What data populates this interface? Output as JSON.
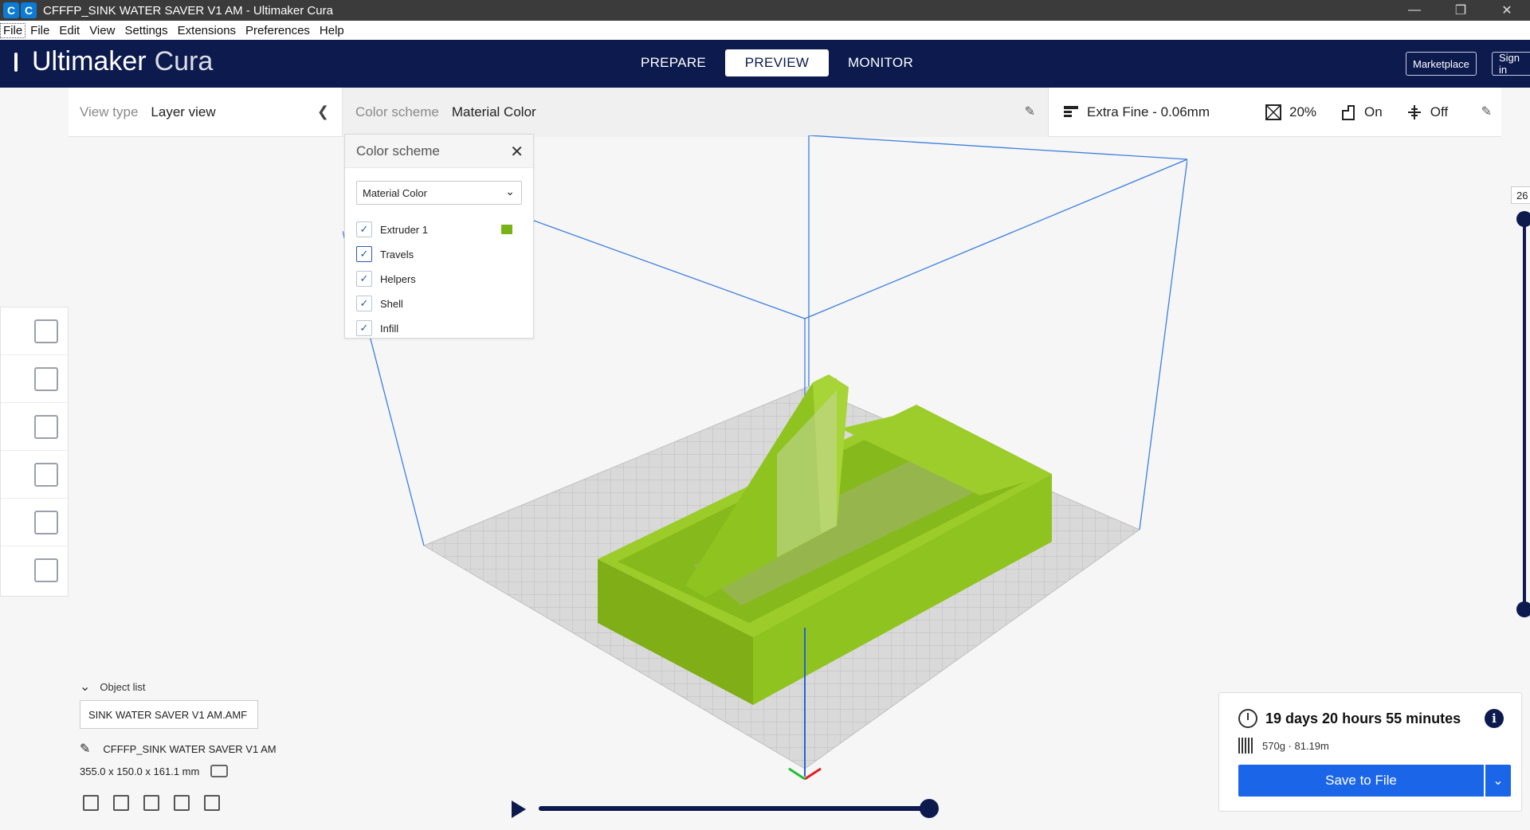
{
  "window": {
    "title": "CFFFP_SINK WATER SAVER V1 AM - Ultimaker Cura",
    "icon": "cura-app-icon"
  },
  "menu": [
    "File",
    "File",
    "Edit",
    "View",
    "Settings",
    "Extensions",
    "Preferences",
    "Help"
  ],
  "header": {
    "logo": {
      "name": "Ultimaker",
      "product": "Cura"
    },
    "stages": [
      "PREPARE",
      "PREVIEW",
      "MONITOR"
    ],
    "active_stage": "PREVIEW",
    "marketplace": "Marketplace",
    "signin": "Sign in"
  },
  "viewbar": {
    "view_type_label": "View type",
    "view_type_value": "Layer view",
    "color_scheme_label": "Color scheme",
    "color_scheme_value": "Material Color",
    "profile": "Extra Fine - 0.06mm",
    "infill": "20%",
    "support": "On",
    "adhesion": "Off"
  },
  "color_scheme_popup": {
    "title": "Color scheme",
    "selected": "Material Color",
    "items": [
      {
        "label": "Extruder 1",
        "checked": true,
        "color": "#7ab318"
      },
      {
        "label": "Travels",
        "checked": true
      },
      {
        "label": "Helpers",
        "checked": true
      },
      {
        "label": "Shell",
        "checked": true
      },
      {
        "label": "Infill",
        "checked": true
      }
    ]
  },
  "layer": {
    "current": "26"
  },
  "object_list": {
    "title": "Object list",
    "object": "SINK WATER SAVER V1 AM.AMF",
    "job_name": "CFFFP_SINK WATER SAVER V1 AM",
    "dimensions": "355.0 x 150.0 x 161.1 mm"
  },
  "print_info": {
    "time": "19 days 20 hours 55 minutes",
    "material": "570g · 81.19m",
    "save_label": "Save to File"
  },
  "colors": {
    "header": "#0c1a4e",
    "model": "#8fc31f",
    "accent": "#1b66e8",
    "buildbox": "#3d7fe0"
  }
}
